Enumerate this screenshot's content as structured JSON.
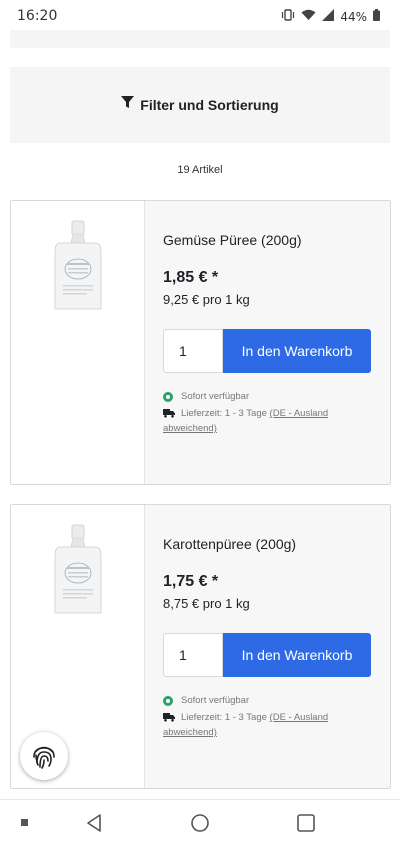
{
  "status_bar": {
    "time": "16:20",
    "battery_percent": "44%",
    "icons": [
      "vibrate-icon",
      "wifi-icon",
      "signal-icon",
      "battery-icon"
    ]
  },
  "filter": {
    "label": "Filter und Sortierung",
    "icon": "filter-icon"
  },
  "item_count": "19 Artikel",
  "products": [
    {
      "name": "Gemüse Püree (200g)",
      "price": "1,85 € *",
      "unit_price": "9,25 € pro 1 kg",
      "quantity": "1",
      "cart_button": "In den Warenkorb",
      "availability": "Sofort verfügbar",
      "delivery_prefix": "Lieferzeit: 1 - 3 Tage",
      "delivery_link": "(DE - Ausland abweichend)"
    },
    {
      "name": "Karottenpüree (200g)",
      "price": "1,75 € *",
      "unit_price": "8,75 € pro 1 kg",
      "quantity": "1",
      "cart_button": "In den Warenkorb",
      "availability": "Sofort verfügbar",
      "delivery_prefix": "Lieferzeit: 1 - 3 Tage",
      "delivery_link": "(DE - Ausland abweichend)"
    }
  ],
  "colors": {
    "accent": "#2e6ae6",
    "available": "#2ba16c",
    "panel": "#f5f5f5"
  },
  "nav_bar": {
    "buttons": [
      "recent-apps-icon",
      "back-icon",
      "home-icon",
      "overview-icon"
    ]
  }
}
